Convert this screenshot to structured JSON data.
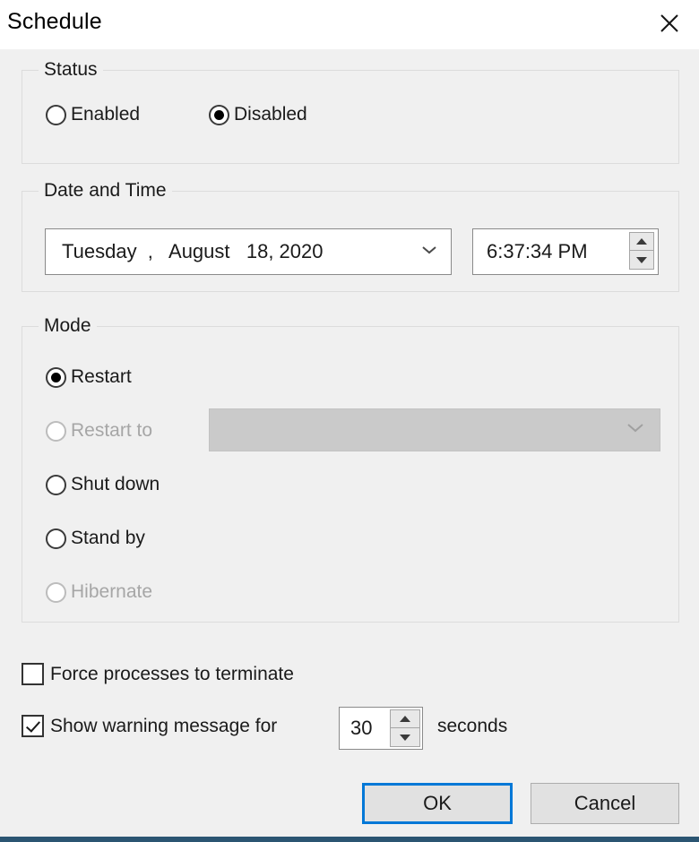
{
  "window": {
    "title": "Schedule",
    "close_icon": "close-icon"
  },
  "status_group": {
    "legend": "Status",
    "options": [
      {
        "label": "Enabled",
        "checked": false,
        "disabled": false
      },
      {
        "label": "Disabled",
        "checked": true,
        "disabled": false
      }
    ]
  },
  "datetime_group": {
    "legend": "Date and Time",
    "date_value": "Tuesday  ,   August   18, 2020",
    "date_chevron_icon": "chevron-down-icon",
    "time_value": "6:37:34 PM",
    "spinner_up_icon": "triangle-up-icon",
    "spinner_down_icon": "triangle-down-icon"
  },
  "mode_group": {
    "legend": "Mode",
    "options": [
      {
        "label": "Restart",
        "checked": true,
        "disabled": false
      },
      {
        "label": "Restart to",
        "checked": false,
        "disabled": true
      },
      {
        "label": "Shut down",
        "checked": false,
        "disabled": false
      },
      {
        "label": "Stand by",
        "checked": false,
        "disabled": false
      },
      {
        "label": "Hibernate",
        "checked": false,
        "disabled": true
      }
    ],
    "restart_to_combo": {
      "value": "",
      "disabled": true,
      "chevron_icon": "chevron-down-icon"
    }
  },
  "options": {
    "force_terminate": {
      "label": "Force processes to terminate",
      "checked": false
    },
    "show_warning": {
      "label": "Show warning message for",
      "checked": true
    },
    "seconds_value": "30",
    "seconds_suffix": "seconds"
  },
  "footer": {
    "ok_label": "OK",
    "cancel_label": "Cancel"
  },
  "colors": {
    "accent": "#0078d7",
    "dialog_bg": "#f0f0f0",
    "titlebar_bg": "#ffffff",
    "bottom_strip": "#2b5572",
    "disabled_text": "#a6a6a6",
    "disabled_combo_bg": "#cacaca"
  }
}
